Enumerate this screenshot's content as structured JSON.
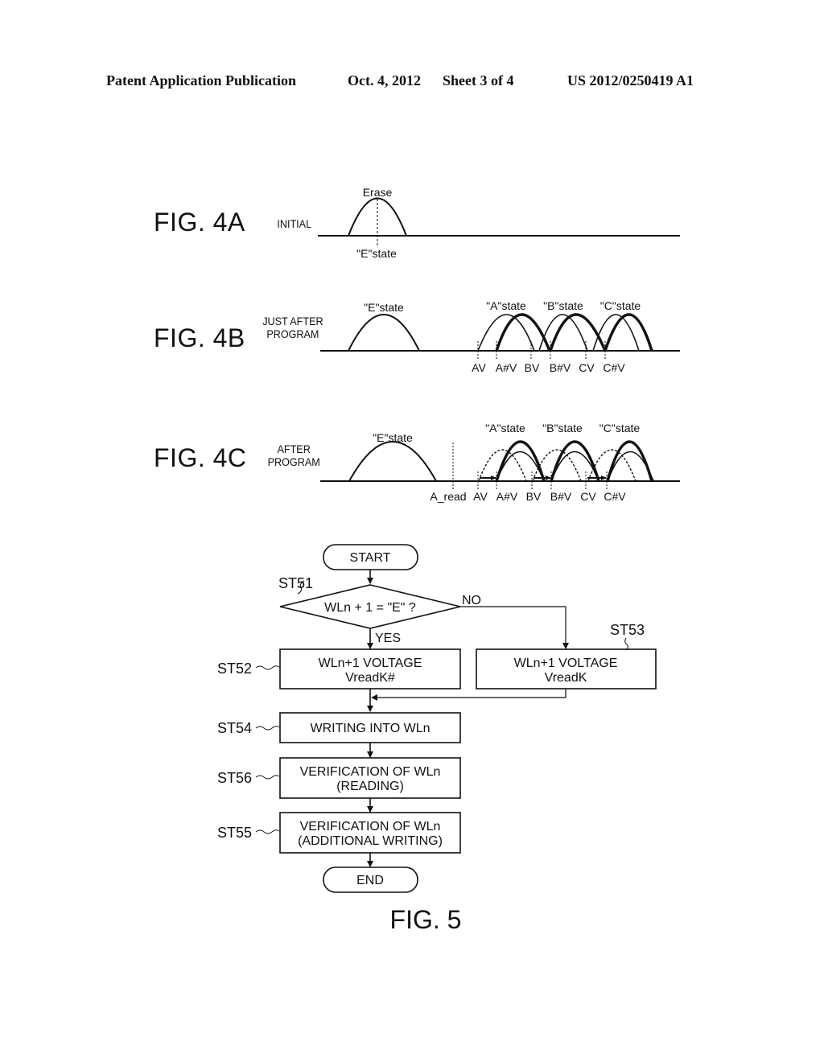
{
  "header": {
    "publication": "Patent Application Publication",
    "date": "Oct. 4, 2012",
    "sheet": "Sheet 3 of 4",
    "number": "US 2012/0250419 A1"
  },
  "fig4a": {
    "label": "FIG. 4A",
    "condition": "INITIAL",
    "peak_label": "Erase",
    "state_label": "\"E\"state"
  },
  "fig4b": {
    "label": "FIG. 4B",
    "condition_line1": "JUST AFTER",
    "condition_line2": "PROGRAM",
    "state_labels": [
      "\"E\"state",
      "\"A\"state",
      "\"B\"state",
      "\"C\"state"
    ],
    "voltage_labels": [
      "AV",
      "A#V",
      "BV",
      "B#V",
      "CV",
      "C#V"
    ]
  },
  "fig4c": {
    "label": "FIG. 4C",
    "condition_line1": "AFTER",
    "condition_line2": "PROGRAM",
    "state_labels": [
      "\"E\"state",
      "\"A\"state",
      "\"B\"state",
      "\"C\"state"
    ],
    "read_label": "A_read",
    "voltage_labels": [
      "AV",
      "A#V",
      "BV",
      "B#V",
      "CV",
      "C#V"
    ]
  },
  "fig5": {
    "label": "FIG. 5",
    "start": "START",
    "end": "END",
    "decision": {
      "step": "ST51",
      "text": "WLn + 1 = \"E\" ?",
      "yes": "YES",
      "no": "NO"
    },
    "st52": {
      "step": "ST52",
      "line1": "WLn+1 VOLTAGE",
      "line2": "VreadK#"
    },
    "st53": {
      "step": "ST53",
      "line1": "WLn+1 VOLTAGE",
      "line2": "VreadK"
    },
    "st54": {
      "step": "ST54",
      "line1": "WRITING INTO WLn"
    },
    "st56": {
      "step": "ST56",
      "line1": "VERIFICATION OF WLn",
      "line2": "(READING)"
    },
    "st55": {
      "step": "ST55",
      "line1": "VERIFICATION OF WLn",
      "line2": "(ADDITIONAL WRITING)"
    }
  }
}
